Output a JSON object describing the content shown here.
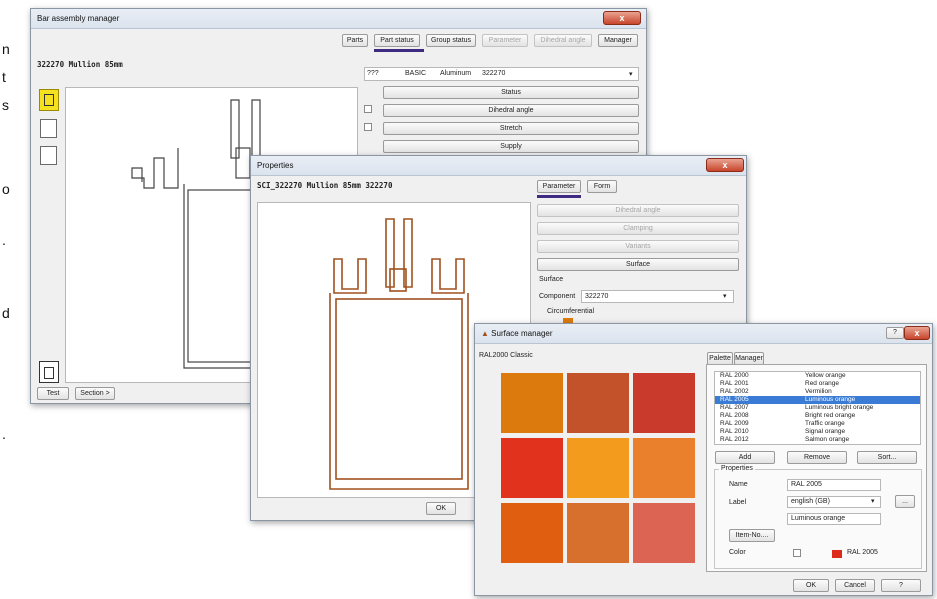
{
  "left_text_fragments": [
    "n",
    "t",
    "s",
    "o",
    ".",
    "d",
    "."
  ],
  "bar_window": {
    "title": "Bar assembly manager",
    "close": "x",
    "tabs": [
      "Parts",
      "Part status",
      "Group status",
      "Parameter",
      "Dihedral angle",
      "Manager"
    ],
    "profile_title": "322270 Mullion 85mm",
    "selector": {
      "code": "???",
      "status": "BASIC",
      "material": "Aluminum",
      "number": "322270"
    },
    "actions": [
      "Status",
      "Dihedral angle",
      "Stretch",
      "Supply"
    ],
    "bottom_buttons": [
      "Test",
      "Section >"
    ]
  },
  "properties_window": {
    "title": "Properties",
    "close": "x",
    "profile_title": "SCI_322270 Mullion 85mm 322270",
    "tabs": [
      "Parameter",
      "Form"
    ],
    "actions": [
      "Dihedral angle",
      "Clamping",
      "Variants",
      "Surface"
    ],
    "surface_label": "Surface",
    "component_label": "Component",
    "component_value": "322270",
    "circumferential_label": "Circumferential",
    "ok": "OK"
  },
  "surface_window": {
    "title": "Surface manager",
    "help": "?",
    "close": "x",
    "palette_name": "RAL2000 Classic",
    "tabs": [
      "Palette",
      "Manager"
    ],
    "list": [
      {
        "code": "RAL 2000",
        "name": "Yellow orange",
        "selected": false
      },
      {
        "code": "RAL 2001",
        "name": "Red orange",
        "selected": false
      },
      {
        "code": "RAL 2002",
        "name": "Vermilion",
        "selected": false
      },
      {
        "code": "RAL 2005",
        "name": "Luminous orange",
        "selected": true
      },
      {
        "code": "RAL 2007",
        "name": "Luminous bright orange",
        "selected": false
      },
      {
        "code": "RAL 2008",
        "name": "Bright red orange",
        "selected": false
      },
      {
        "code": "RAL 2009",
        "name": "Traffic orange",
        "selected": false
      },
      {
        "code": "RAL 2010",
        "name": "Signal orange",
        "selected": false
      },
      {
        "code": "RAL 2012",
        "name": "Salmon orange",
        "selected": false
      }
    ],
    "add": "Add",
    "remove": "Remove",
    "sort": "Sort...",
    "properties_label": "Properties",
    "name_label": "Name",
    "name_value": "RAL 2005",
    "label_label": "Label",
    "label_value": "english (GB)",
    "label_text": "Luminous orange",
    "more": "...",
    "item_no": "Item-No....",
    "color_label": "Color",
    "color_value": "RAL 2005",
    "ok": "OK",
    "cancel": "Cancel",
    "help_button": "?",
    "colors": [
      "#dd7a0e",
      "#c3512a",
      "#c93a2d",
      "#e0321c",
      "#f29b1d",
      "#ea7f2c",
      "#df5e10",
      "#d6702c",
      "#dc6452"
    ],
    "selected_color": "#dd2a1a"
  }
}
